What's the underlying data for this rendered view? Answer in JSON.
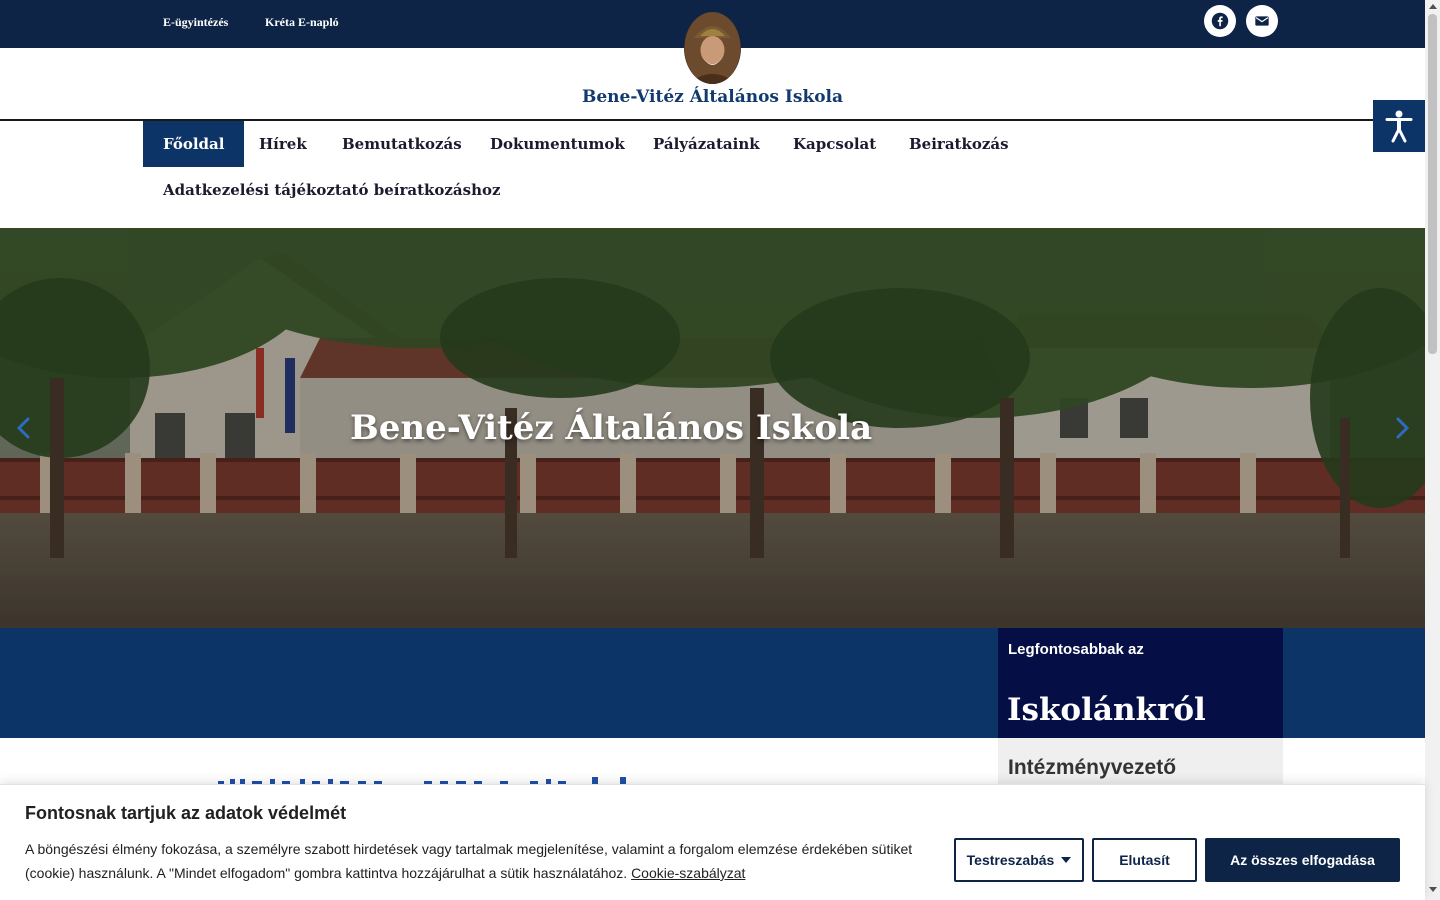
{
  "topbar": {
    "links": [
      "E-ügyintézés",
      "Kréta E-napló"
    ],
    "social": [
      {
        "icon": "facebook-icon"
      },
      {
        "icon": "envelope-icon"
      }
    ]
  },
  "site": {
    "name": "Bene-Vitéz Általános Iskola"
  },
  "nav": {
    "items": [
      "Főoldal",
      "Hírek",
      "Bemutatkozás",
      "Dokumentumok",
      "Pályázataink",
      "Kapcsolat",
      "Beiratkozás",
      "Adatkezelési tájékoztató beíratkozáshoz"
    ],
    "active": "Főoldal"
  },
  "hero": {
    "title": "Bene-Vitéz Általános Iskola"
  },
  "sidebar": {
    "small": "Legfontosabbak az",
    "big": "Iskolánkról",
    "sub": "Intézményvezető"
  },
  "cookie": {
    "title": "Fontosnak tartjuk az adatok védelmét",
    "text": "A böngészési élmény fokozása, a személyre szabott hirdetések vagy tartalmak megjelenítése, valamint a forgalom elemzése érdekében sütiket (cookie) használunk. A \"Mindet elfogadom\" gombra kattintva hozzájárulhat a sütik használatához.",
    "policy_link": "Cookie-szabályzat",
    "customize": "Testreszabás",
    "reject": "Elutasít",
    "accept_all": "Az összes elfogadása"
  },
  "colors": {
    "navy": "#0d2447",
    "blue": "#0d3466",
    "dark_box": "#060f45"
  }
}
